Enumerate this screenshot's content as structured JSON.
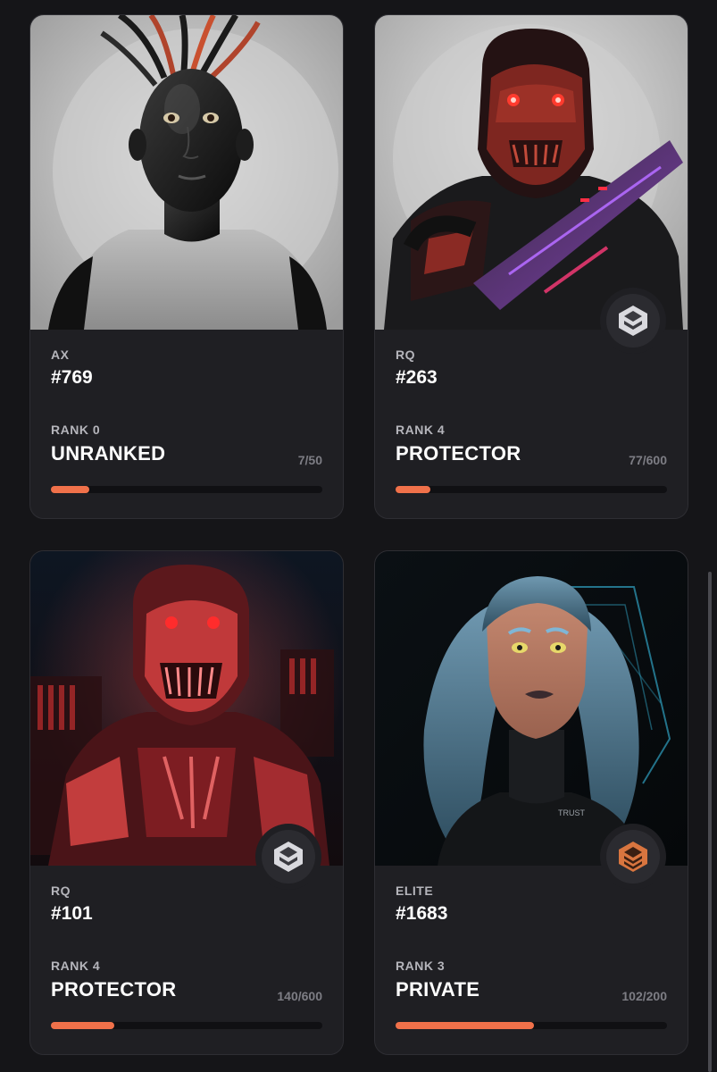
{
  "accent_color": "#f0714a",
  "cards": [
    {
      "collection": "AX",
      "number": "#769",
      "rank_label": "RANK 0",
      "rank_name": "UNRANKED",
      "progress_text": "7/50",
      "progress": 0.14,
      "badge": null
    },
    {
      "collection": "RQ",
      "number": "#263",
      "rank_label": "RANK 4",
      "rank_name": "PROTECTOR",
      "progress_text": "77/600",
      "progress": 0.128,
      "badge": "silver-layers-icon"
    },
    {
      "collection": "RQ",
      "number": "#101",
      "rank_label": "RANK 4",
      "rank_name": "PROTECTOR",
      "progress_text": "140/600",
      "progress": 0.233,
      "badge": "silver-layers-icon"
    },
    {
      "collection": "ELITE",
      "number": "#1683",
      "rank_label": "RANK 3",
      "rank_name": "PRIVATE",
      "progress_text": "102/200",
      "progress": 0.51,
      "badge": "bronze-layers-icon"
    }
  ]
}
